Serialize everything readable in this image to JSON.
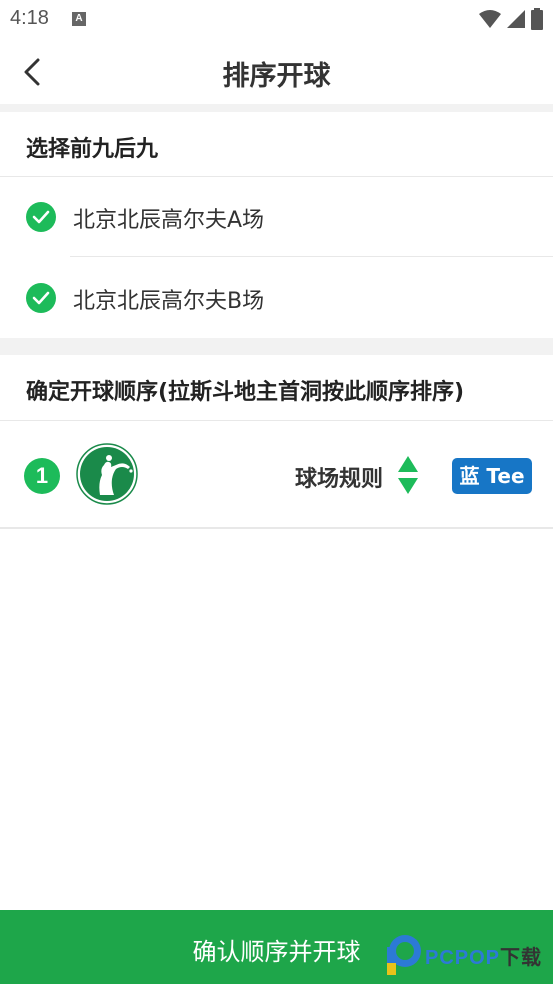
{
  "status_bar": {
    "time": "4:18",
    "notification_badge": "A"
  },
  "header": {
    "title": "排序开球",
    "back_icon": "chevron-left-icon"
  },
  "section_nine": {
    "title": "选择前九后九",
    "courses": [
      {
        "label": "北京北辰高尔夫A场",
        "checked": true
      },
      {
        "label": "北京北辰高尔夫B场",
        "checked": true
      }
    ]
  },
  "section_order": {
    "title": "确定开球顺序(拉斯斗地主首洞按此顺序排序)",
    "rows": [
      {
        "number": "1",
        "rule_label": "球场规则",
        "tee_label": "蓝 Tee"
      }
    ]
  },
  "footer": {
    "confirm_label": "确认顺序并开球"
  },
  "watermark": {
    "brand": "PCPOP",
    "suffix": "下载"
  },
  "colors": {
    "accent_green": "#1dbb5a",
    "button_green": "#1ea64a",
    "tee_blue": "#1776c6"
  }
}
